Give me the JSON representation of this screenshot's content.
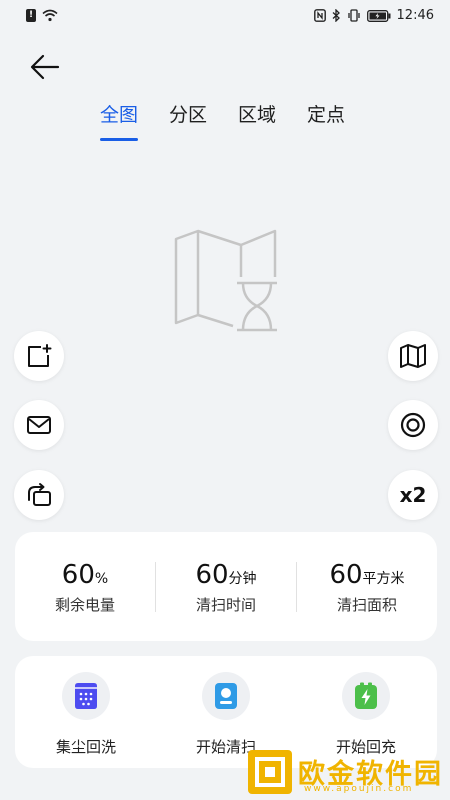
{
  "status_bar": {
    "time": "12:46"
  },
  "tabs": [
    {
      "label": "全图",
      "active": true
    },
    {
      "label": "分区",
      "active": false
    },
    {
      "label": "区域",
      "active": false
    },
    {
      "label": "定点",
      "active": false
    }
  ],
  "side_buttons": {
    "left": [
      {
        "icon": "add-room-icon"
      },
      {
        "icon": "mail-icon"
      },
      {
        "icon": "rotate-icon"
      }
    ],
    "right": [
      {
        "icon": "map-icon"
      },
      {
        "icon": "target-icon"
      },
      {
        "label": "x2"
      }
    ]
  },
  "stats": [
    {
      "value": "60",
      "unit": "%",
      "label": "剩余电量"
    },
    {
      "value": "60",
      "unit": "分钟",
      "label": "清扫时间"
    },
    {
      "value": "60",
      "unit": "平方米",
      "label": "清扫面积"
    }
  ],
  "actions": [
    {
      "label": "集尘回洗",
      "icon": "dust-collect-icon",
      "color": "#4d4cf0"
    },
    {
      "label": "开始清扫",
      "icon": "start-clean-icon",
      "color": "#2f9be6"
    },
    {
      "label": "开始回充",
      "icon": "battery-charge-icon",
      "color": "#4cbf4a"
    }
  ],
  "watermark": {
    "text": "欧金软件园",
    "url": "www.apoujin.com"
  },
  "colors": {
    "accent": "#1a5ee6",
    "background": "#f1f3f5",
    "watermark": "#f0b400"
  }
}
